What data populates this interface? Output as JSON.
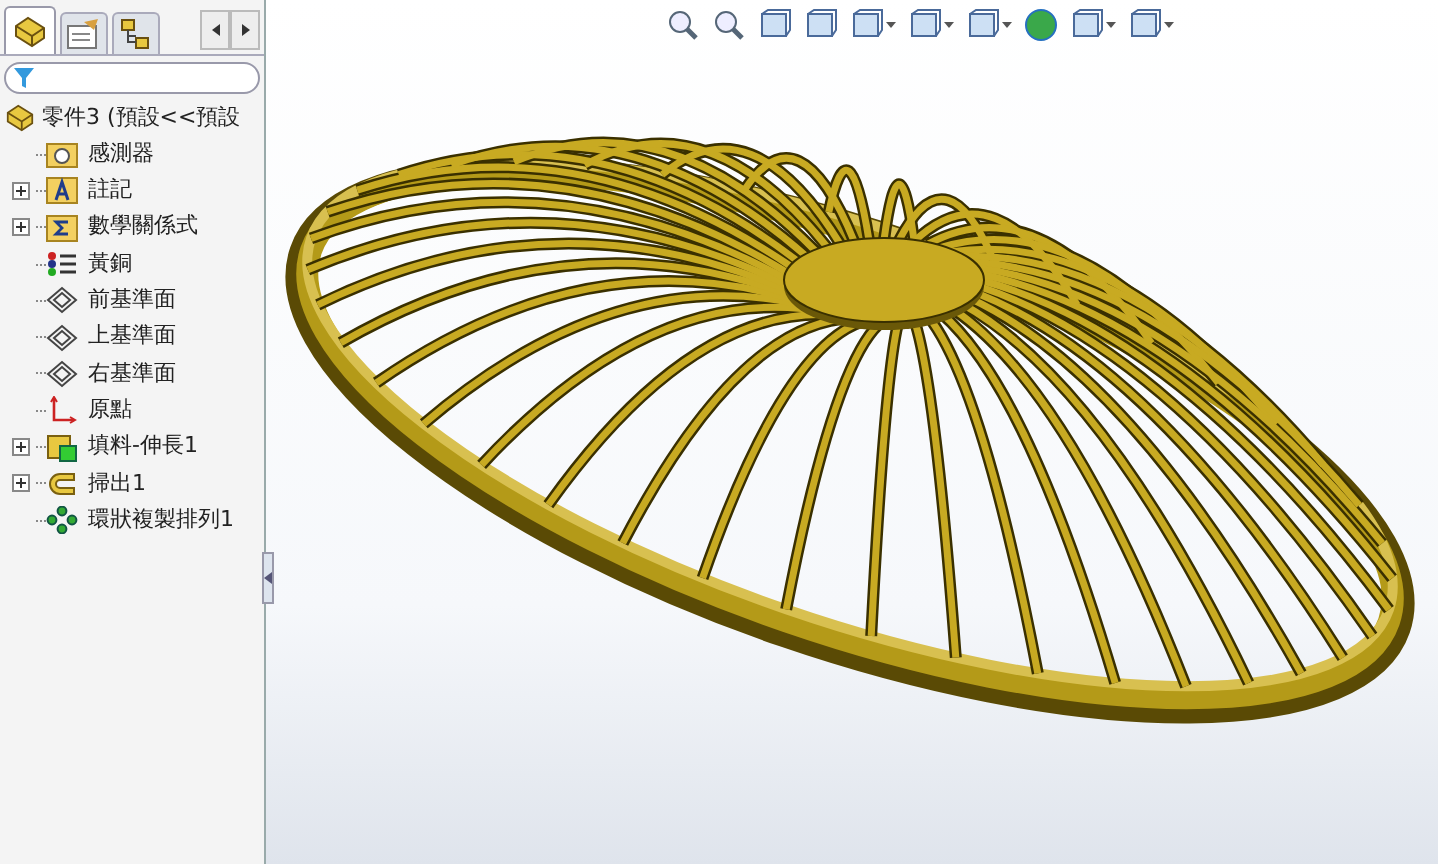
{
  "panel_tabs": [
    {
      "kind": "feature-tree",
      "selected": true
    },
    {
      "kind": "property",
      "selected": false
    },
    {
      "kind": "config",
      "selected": false
    }
  ],
  "tree": {
    "root": {
      "label": "零件3 (預設<<預設"
    },
    "items": [
      {
        "label": "感測器",
        "kind": "sensor",
        "expandable": false
      },
      {
        "label": "註記",
        "kind": "annotation",
        "expandable": true
      },
      {
        "label": "數學關係式",
        "kind": "equation",
        "expandable": true
      },
      {
        "label": "黃銅",
        "kind": "material",
        "expandable": false
      },
      {
        "label": "前基準面",
        "kind": "plane",
        "expandable": false
      },
      {
        "label": "上基準面",
        "kind": "plane",
        "expandable": false
      },
      {
        "label": "右基準面",
        "kind": "plane",
        "expandable": false
      },
      {
        "label": "原點",
        "kind": "origin",
        "expandable": false
      },
      {
        "label": "填料-伸長1",
        "kind": "extrude",
        "expandable": true
      },
      {
        "label": "掃出1",
        "kind": "sweep",
        "expandable": true
      },
      {
        "label": "環狀複製排列1",
        "kind": "pattern",
        "expandable": false
      }
    ]
  }
}
